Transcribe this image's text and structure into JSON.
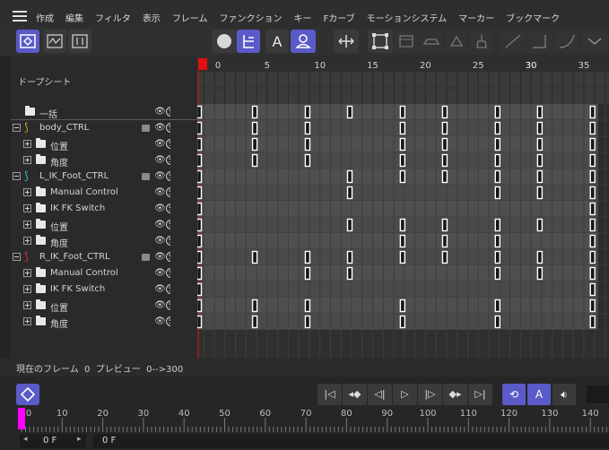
{
  "menu": {
    "items": [
      "作成",
      "編集",
      "フィルタ",
      "表示",
      "フレーム",
      "ファンクション",
      "キー",
      "Fカーブ",
      "モーションシステム",
      "マーカー",
      "ブックマーク"
    ]
  },
  "toolbar": {
    "icons": [
      "dopesheet-mode-icon",
      "fcurve-mode-icon",
      "motion-mode-icon",
      "sphere-icon",
      "hierarchy-icon",
      "text-a-icon",
      "user-icon",
      "move-horizontal-icon",
      "frame-select-icon",
      "film-icon",
      "car-icon",
      "motion-path-icon",
      "brush-icon",
      "linear-curve-icon",
      "step-curve-icon",
      "ease-curve-icon",
      "more-chevron-icon"
    ]
  },
  "sheet": {
    "title": "ドープシート",
    "ruler_ticks": [
      "0",
      "5",
      "10",
      "15",
      "20",
      "25",
      "30",
      "35"
    ]
  },
  "tracks": [
    {
      "label": "一括",
      "indent": 0,
      "type": "summary"
    },
    {
      "label": "body_CTRL",
      "indent": 0,
      "type": "object",
      "color": "#e0a030"
    },
    {
      "label": "位置",
      "indent": 1,
      "type": "folder"
    },
    {
      "label": "角度",
      "indent": 1,
      "type": "folder"
    },
    {
      "label": "L_IK_Foot_CTRL",
      "indent": 0,
      "type": "object",
      "color": "#30c8d0"
    },
    {
      "label": "Manual Control",
      "indent": 1,
      "type": "folder"
    },
    {
      "label": "IK FK Switch",
      "indent": 1,
      "type": "folder"
    },
    {
      "label": "位置",
      "indent": 1,
      "type": "folder"
    },
    {
      "label": "角度",
      "indent": 1,
      "type": "folder"
    },
    {
      "label": "R_IK_Foot_CTRL",
      "indent": 0,
      "type": "object",
      "color": "#e03030"
    },
    {
      "label": "Manual Control",
      "indent": 1,
      "type": "folder"
    },
    {
      "label": "IK FK Switch",
      "indent": 1,
      "type": "folder"
    },
    {
      "label": "位置",
      "indent": 1,
      "type": "folder"
    },
    {
      "label": "角度",
      "indent": 1,
      "type": "folder"
    }
  ],
  "keys_by_row": [
    [
      0,
      4,
      9,
      13,
      18,
      22,
      27,
      31,
      36
    ],
    [
      0,
      4,
      9,
      18,
      22,
      27,
      31,
      36
    ],
    [
      0,
      4,
      9,
      18,
      22,
      27,
      31,
      36
    ],
    [
      0,
      4,
      9,
      18,
      22,
      27,
      31,
      36
    ],
    [
      0,
      13,
      18,
      22,
      27,
      31,
      36
    ],
    [
      0,
      13,
      27,
      31,
      36
    ],
    [
      0,
      36
    ],
    [
      0,
      13,
      18,
      22,
      27,
      31,
      36
    ],
    [
      0,
      18,
      22,
      27,
      36
    ],
    [
      0,
      4,
      9,
      13,
      18,
      22,
      27,
      31,
      36
    ],
    [
      0,
      9,
      13,
      27,
      31,
      36
    ],
    [
      0,
      36
    ],
    [
      0,
      4,
      9,
      18,
      27,
      36
    ],
    [
      0,
      4,
      9,
      18,
      27,
      36
    ]
  ],
  "status": {
    "text": "現在のフレーム  0  プレビュー  0-->300"
  },
  "transport": {
    "ruler_ticks": [
      "0",
      "10",
      "20",
      "30",
      "40",
      "50",
      "60",
      "70",
      "80",
      "90",
      "100",
      "110",
      "120",
      "130",
      "140"
    ],
    "current_frame": "0 F",
    "end_frame": "0 F",
    "icons": [
      "keyframe-diamond-icon",
      "goto-start-icon",
      "prev-key-icon",
      "prev-frame-icon",
      "play-icon",
      "next-frame-icon",
      "next-key-icon",
      "goto-end-icon",
      "loop-icon",
      "auto-key-icon",
      "sound-icon"
    ]
  }
}
